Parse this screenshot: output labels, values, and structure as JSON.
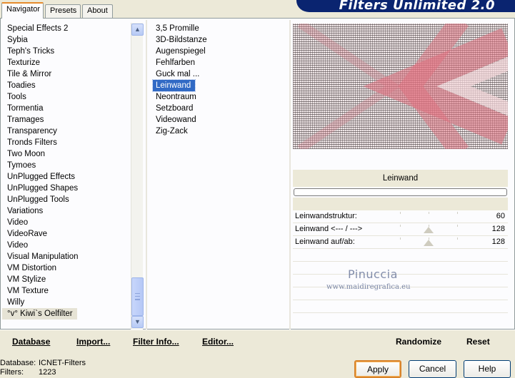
{
  "tabs": [
    {
      "label": "Navigator",
      "active": true
    },
    {
      "label": "Presets",
      "active": false
    },
    {
      "label": "About",
      "active": false
    }
  ],
  "banner_title": "Filters Unlimited 2.0",
  "categories": [
    "Special Effects 2",
    "Sybia",
    "Teph's Tricks",
    "Texturize",
    "Tile & Mirror",
    "Toadies",
    "Tools",
    "Tormentia",
    "Tramages",
    "Transparency",
    "Tronds Filters",
    "Two Moon",
    "Tymoes",
    "UnPlugged Effects",
    "UnPlugged Shapes",
    "UnPlugged Tools",
    "Variations",
    "Video",
    "VideoRave",
    "Video",
    "Visual Manipulation",
    "VM Distortion",
    "VM Stylize",
    "VM Texture",
    "Willy",
    "°v° Kiwi`s Oelfilter"
  ],
  "selected_category_index": 25,
  "filters": [
    "3,5 Promille",
    "3D-Bildstanze",
    "Augenspiegel",
    "Fehlfarben",
    "Guck mal ...",
    "Leinwand",
    "Neontraum",
    "Setzboard",
    "Videowand",
    "Zig-Zack"
  ],
  "selected_filter_index": 5,
  "preview": {
    "filter_name": "Leinwand",
    "colors": {
      "grid": "#333333",
      "shape": "#e0707e",
      "background": "#f2f2f2"
    }
  },
  "params": [
    {
      "label": "Leinwandstruktur:",
      "value": "60",
      "level": 0.235
    },
    {
      "label": "Leinwand <--- / --->",
      "value": "128",
      "level": 0.5
    },
    {
      "label": "Leinwand auf/ab:",
      "value": "128",
      "level": 0.5
    }
  ],
  "watermark": {
    "name": "Pinuccia",
    "url": "www.maidiregrafica.eu"
  },
  "actions": {
    "database": "Database",
    "import": "Import...",
    "filter_info": "Filter Info...",
    "editor": "Editor...",
    "randomize": "Randomize",
    "reset": "Reset"
  },
  "status": {
    "database_label": "Database:",
    "database_value": "ICNET-Filters",
    "filters_label": "Filters:",
    "filters_value": "1223"
  },
  "buttons": {
    "apply": "Apply",
    "cancel": "Cancel",
    "help": "Help"
  },
  "icons": {
    "scroll_up": "chevron-up-icon",
    "scroll_down": "chevron-down-icon"
  }
}
